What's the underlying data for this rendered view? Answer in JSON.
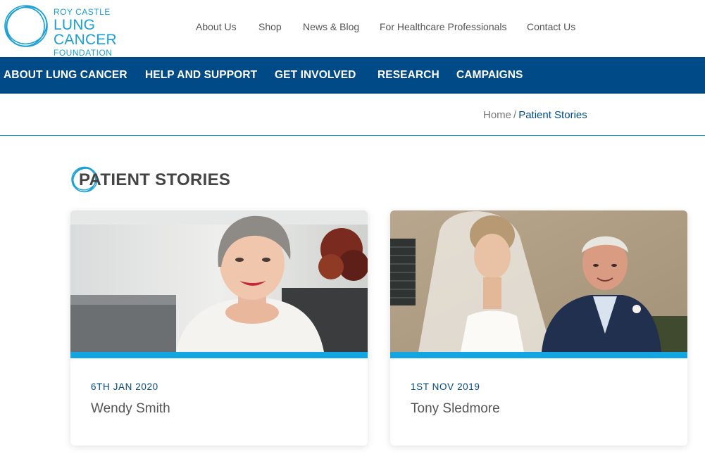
{
  "brand": {
    "line1": "ROY CASTLE",
    "line2": "LUNG CANCER",
    "line3": "FOUNDATION",
    "color": "#1a9fd6"
  },
  "util_nav": [
    "About Us",
    "Shop",
    "News & Blog",
    "For Healthcare Professionals",
    "Contact Us"
  ],
  "main_nav": [
    "ABOUT LUNG CANCER",
    "HELP AND SUPPORT",
    "GET INVOLVED",
    "RESEARCH",
    "CAMPAIGNS"
  ],
  "breadcrumb": {
    "home": "Home",
    "separator": "/",
    "current": "Patient Stories"
  },
  "page_title": "PATIENT STORIES",
  "stories": [
    {
      "date": "6TH JAN 2020",
      "name": "Wendy Smith"
    },
    {
      "date": "1ST NOV 2019",
      "name": "Tony Sledmore"
    }
  ],
  "colors": {
    "nav_bg": "#004b87",
    "accent": "#14a6e2",
    "heading": "#444444"
  },
  "icons": {
    "logo": "circle-logo-icon",
    "heading_mark": "circle-swirl-icon"
  }
}
